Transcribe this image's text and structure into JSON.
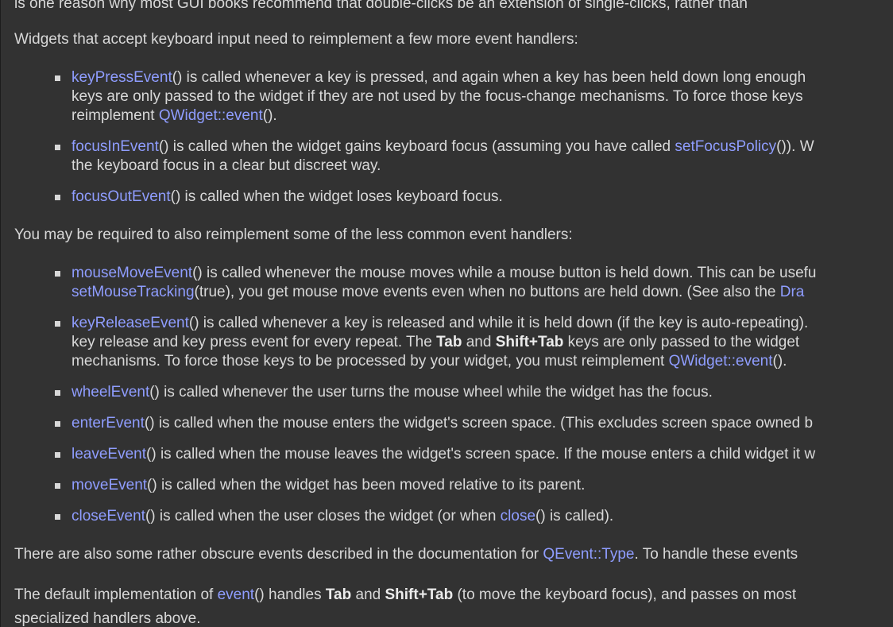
{
  "para_top_cut": "is one reason why most GUI books recommend that double-clicks be an extension of single-clicks, rather than",
  "para_keyboard": "Widgets that accept keyboard input need to reimplement a few more event handlers:",
  "keyPress": {
    "link": "keyPressEvent",
    "l1": "() is called whenever a key is pressed, and again when a key has been held down long enough",
    "l2": "keys are only passed to the widget if they are not used by the focus-change mechanisms. To force those keys",
    "l3a": "reimplement ",
    "l3link": "QWidget::event",
    "l3b": "()."
  },
  "focusIn": {
    "link": "focusInEvent",
    "l1a": "() is called when the widget gains keyboard focus (assuming you have called ",
    "l1link": "setFocusPolicy",
    "l1b": "()). W",
    "l2": "the keyboard focus in a clear but discreet way."
  },
  "focusOut": {
    "link": "focusOutEvent",
    "l1": "() is called when the widget loses keyboard focus."
  },
  "para_less_common": "You may be required to also reimplement some of the less common event handlers:",
  "mouseMove": {
    "link": "mouseMoveEvent",
    "l1": "() is called whenever the mouse moves while a mouse button is held down. This can be usefu",
    "l2link": "setMouseTracking",
    "l2a": "(true), you get mouse move events even when no buttons are held down. (See also the ",
    "l2link2": "Dra"
  },
  "keyRelease": {
    "link": "keyReleaseEvent",
    "l1": "() is called whenever a key is released and while it is held down (if the key is auto-repeating).",
    "l2a": "key release and key press event for every repeat. The ",
    "tab": "Tab",
    "and": " and ",
    "shifttab": "Shift+Tab",
    "l2b": " keys are only passed to the widget",
    "l3a": "mechanisms. To force those keys to be processed by your widget, you must reimplement ",
    "l3link": "QWidget::event",
    "l3b": "()."
  },
  "wheel": {
    "link": "wheelEvent",
    "l1": "() is called whenever the user turns the mouse wheel while the widget has the focus."
  },
  "enter": {
    "link": "enterEvent",
    "l1": "() is called when the mouse enters the widget's screen space. (This excludes screen space owned b"
  },
  "leave": {
    "link": "leaveEvent",
    "l1": "() is called when the mouse leaves the widget's screen space. If the mouse enters a child widget it w"
  },
  "move": {
    "link": "moveEvent",
    "l1": "() is called when the widget has been moved relative to its parent."
  },
  "close": {
    "link": "closeEvent",
    "l1a": "() is called when the user closes the widget (or when ",
    "l1link": "close",
    "l1b": "() is called)."
  },
  "para_obscure": {
    "a": "There are also some rather obscure events described in the documentation for ",
    "link": "QEvent::Type",
    "b": ". To handle these events"
  },
  "para_default": {
    "a": "The default implementation of ",
    "link": "event",
    "b": "() handles ",
    "tab": "Tab",
    "and": " and ",
    "shifttab": "Shift+Tab",
    "c": " (to move the keyboard focus), and passes on most",
    "l2": "specialized handlers above."
  }
}
